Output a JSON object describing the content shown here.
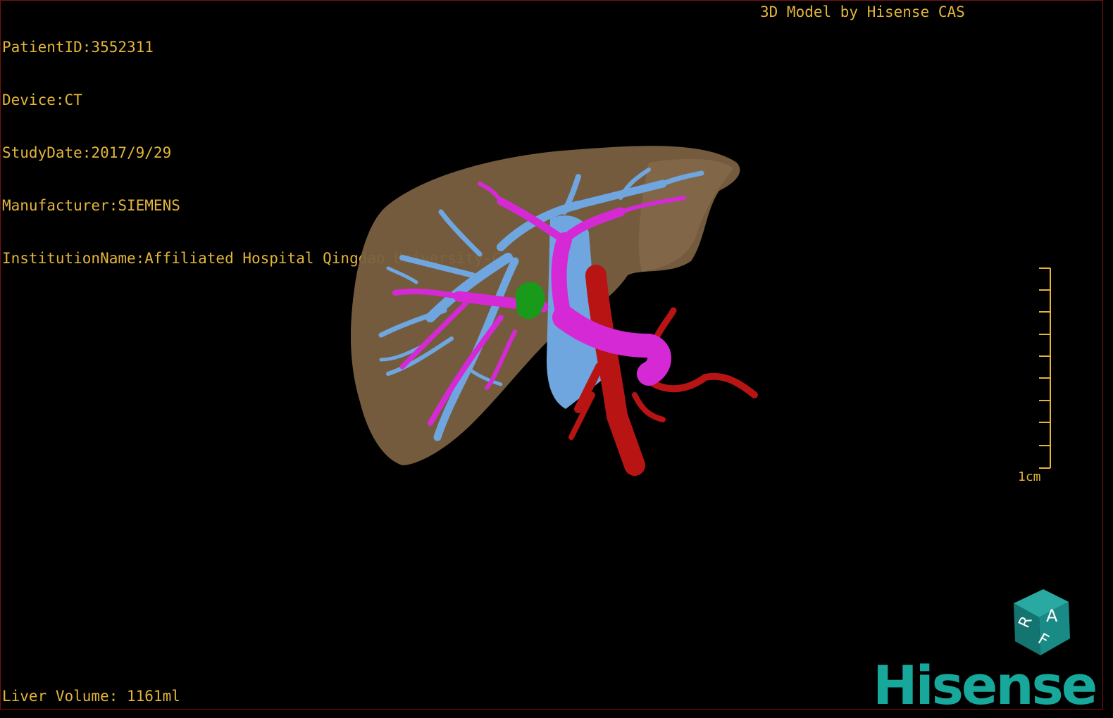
{
  "study": {
    "patient_id": "PatientID:3552311",
    "device": "Device:CT",
    "study_date": "StudyDate:2017/9/29",
    "manufacturer": "Manufacturer:SIEMENS",
    "institution": "InstitutionName:Affiliated Hospital Qingdao University-C"
  },
  "credit": "3D Model by Hisense CAS",
  "liver_volume": "Liver Volume: 1161ml",
  "scale": {
    "label": "1cm"
  },
  "orientation_cube": {
    "labels": [
      "A",
      "R",
      "F"
    ],
    "color": "#1a8a86"
  },
  "logo": "Hisense",
  "colors": {
    "overlay_text": "#e3b53a",
    "liver": "#7a6040",
    "hepatic_vein": "#6fa6e0",
    "portal_vein": "#d629d6",
    "artery": "#b81414",
    "lesion": "#1a9a1a",
    "logo": "#18a79b"
  }
}
